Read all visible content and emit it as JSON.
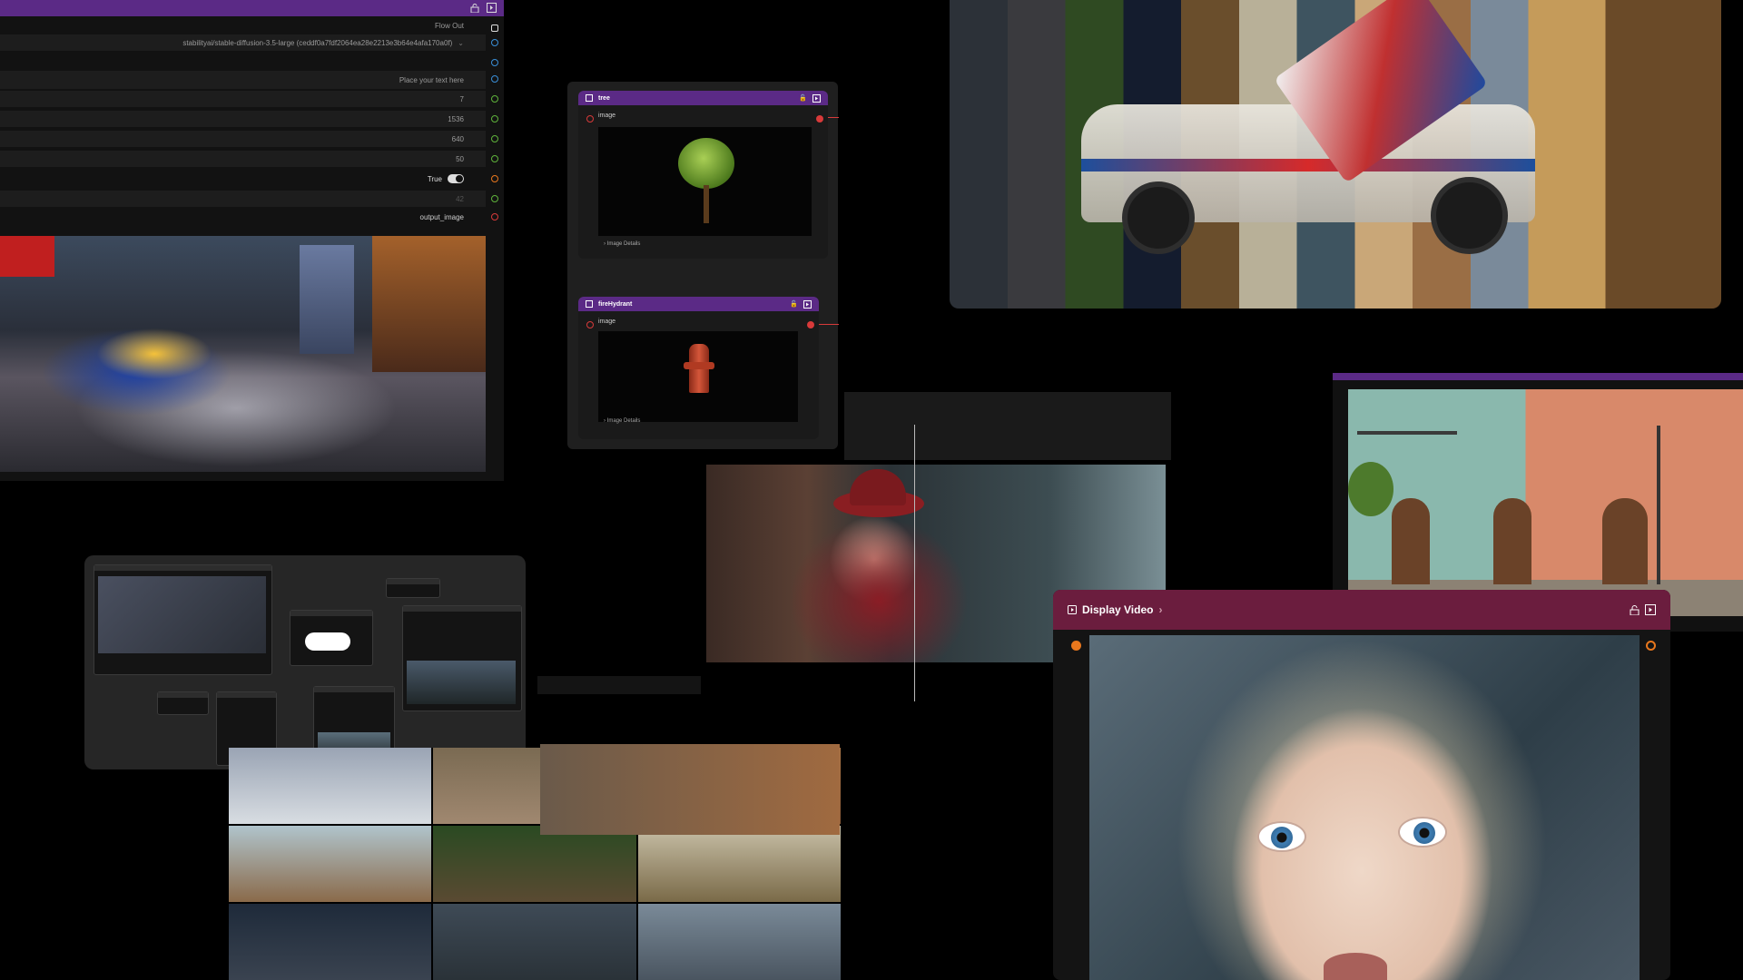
{
  "params_panel": {
    "flow_out_label": "Flow Out",
    "model_value": "stabilityai/stable-diffusion-3.5-large (ceddf0a7fdf2064ea28e2213e3b64e4afa170a0f)",
    "prompt_placeholder": "Place your text here",
    "rows": [
      "7",
      "1536",
      "640",
      "50"
    ],
    "toggle_label": "True",
    "seed_value": "42",
    "output_label": "output_image"
  },
  "tree_node": {
    "title": "tree",
    "port_label": "image",
    "details_label": "Image Details"
  },
  "hydrant_node": {
    "title": "fireHydrant",
    "port_label": "image",
    "details_label": "Image Details"
  },
  "display_video": {
    "title": "Display Video",
    "title_suffix": "›"
  },
  "colors": {
    "node_header": "#5b2a86",
    "video_header": "#6b1d3e",
    "port_green": "#5fb33b",
    "port_blue": "#3a8fd8",
    "port_red": "#d83a3a",
    "port_orange": "#e8771d"
  },
  "icons": [
    "lock-icon",
    "expand-icon",
    "image-icon",
    "chevron-right-icon",
    "toggle-icon"
  ]
}
